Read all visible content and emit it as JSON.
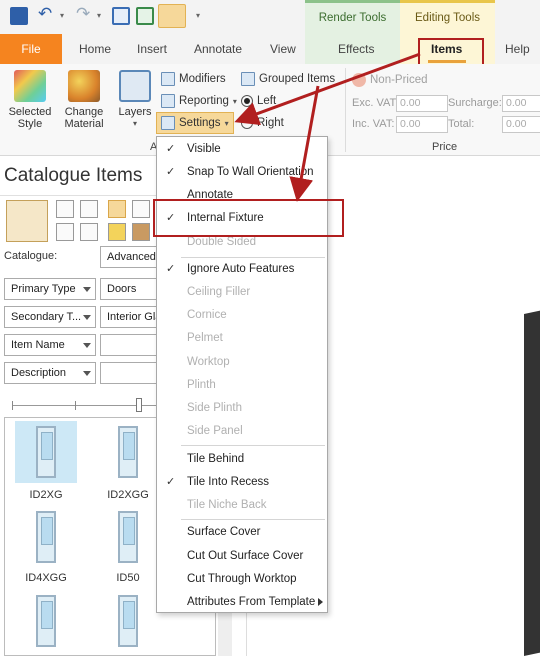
{
  "titlebar": {
    "context_tabs": {
      "render": "Render Tools",
      "editing": "Editing Tools"
    }
  },
  "tabs": {
    "file": "File",
    "home": "Home",
    "insert": "Insert",
    "annotate": "Annotate",
    "view": "View",
    "effects": "Effects",
    "items": "Items",
    "help": "Help"
  },
  "ribbon": {
    "selected_style": "Selected Style",
    "change_material": "Change Material",
    "layers": "Layers",
    "modifiers": "Modifiers",
    "grouped_items": "Grouped Items",
    "reporting": "Reporting",
    "left": "Left",
    "settings": "Settings",
    "right": "Right",
    "group_label_a": "A",
    "non_priced": "Non-Priced",
    "exc_vat": "Exc. VAT:",
    "inc_vat": "Inc. VAT:",
    "surcharge": "Surcharge:",
    "total": "Total:",
    "exc_vat_value": "0.00",
    "inc_vat_value": "0.00",
    "surcharge_value": "0.00",
    "total_value": "0.00",
    "price_label": "Price"
  },
  "catalogue": {
    "title": "Catalogue Items",
    "catalogue_label": "Catalogue:",
    "catalogue_value": "Advanced",
    "primary_type": "Primary Type",
    "primary_value": "Doors",
    "secondary_type": "Secondary T...",
    "secondary_value": "Interior Gla",
    "item_name": "Item Name",
    "description": "Description",
    "thumbs": [
      "ID2XG",
      "ID2XGG",
      "ID4XGG",
      "ID50"
    ]
  },
  "menu": {
    "items": [
      {
        "label": "Visible",
        "checked": true,
        "disabled": false
      },
      {
        "label": "Snap To Wall Orientation",
        "checked": true,
        "disabled": false
      },
      {
        "label": "Annotate",
        "checked": false,
        "disabled": false
      },
      {
        "label": "Internal Fixture",
        "checked": true,
        "disabled": false
      },
      {
        "label": "Double Sided",
        "checked": false,
        "disabled": true
      },
      {
        "label": "Ignore Auto Features",
        "checked": true,
        "disabled": false
      },
      {
        "label": "Ceiling Filler",
        "checked": false,
        "disabled": true
      },
      {
        "label": "Cornice",
        "checked": false,
        "disabled": true
      },
      {
        "label": "Pelmet",
        "checked": false,
        "disabled": true
      },
      {
        "label": "Worktop",
        "checked": false,
        "disabled": true
      },
      {
        "label": "Plinth",
        "checked": false,
        "disabled": true
      },
      {
        "label": "Side Plinth",
        "checked": false,
        "disabled": true
      },
      {
        "label": "Side Panel",
        "checked": false,
        "disabled": true
      },
      {
        "label": "Tile Behind",
        "checked": false,
        "disabled": false
      },
      {
        "label": "Tile Into Recess",
        "checked": true,
        "disabled": false
      },
      {
        "label": "Tile Niche Back",
        "checked": false,
        "disabled": true
      },
      {
        "label": "Surface Cover",
        "checked": false,
        "disabled": false
      },
      {
        "label": "Cut Out Surface Cover",
        "checked": false,
        "disabled": false
      },
      {
        "label": "Cut Through Worktop",
        "checked": false,
        "disabled": false
      },
      {
        "label": "Attributes From Template",
        "checked": false,
        "disabled": false,
        "submenu": true
      }
    ],
    "check_glyph": "✓"
  },
  "colors": {
    "file_tab": "#f5841f",
    "highlight_red": "#b11f1f",
    "settings_highlight": "#f6d89a"
  }
}
